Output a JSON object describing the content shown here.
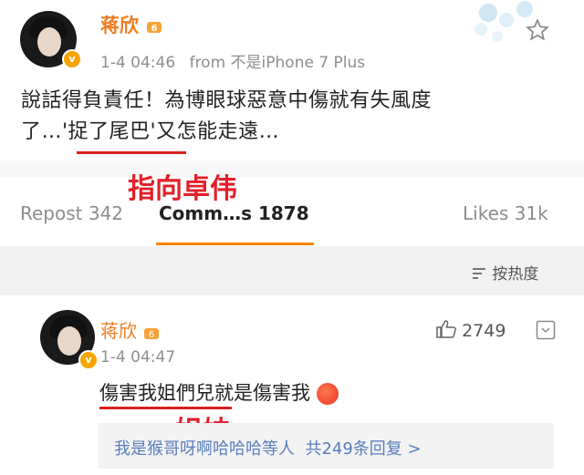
{
  "post": {
    "username": "蒋欣",
    "timestamp": "1-4 04:46",
    "source": "from 不是iPhone 7 Plus",
    "line1": "說話得負責任！為博眼球惡意中傷就有失風度",
    "line2": "了…'捉了尾巴'又怎能走遠…",
    "verified_badge": "v"
  },
  "annotations": {
    "pointer": "指向卓伟",
    "sister": "姐妹"
  },
  "actions": {
    "repost": "Repost 342",
    "comments": "Comm…s 1878",
    "likes": "Likes 31k"
  },
  "sort": {
    "label": "按热度",
    "icon": "sort-icon"
  },
  "comment": {
    "username": "蒋欣",
    "timestamp": "1-4 04:47",
    "text": "傷害我姐們兒就是傷害我",
    "like_count": "2749",
    "reply_summary": "我是猴哥呀啊哈哈哈等人  共249条回复 >",
    "verified_badge": "v"
  },
  "colors": {
    "username": "#f07c1e",
    "annotation": "#e1202a",
    "tab_indicator": "#ff8200",
    "link": "#5a7ebd"
  }
}
